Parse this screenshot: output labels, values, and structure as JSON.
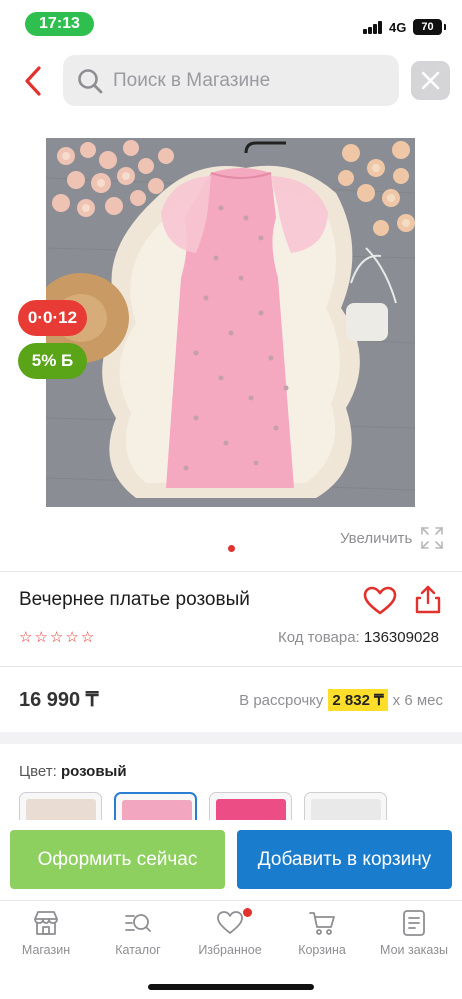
{
  "status_bar": {
    "time": "17:13",
    "network": "4G",
    "battery": "70"
  },
  "search": {
    "placeholder": "Поиск в Магазине"
  },
  "product": {
    "badge_timer": "0·0·12",
    "badge_cashback": "5% Б",
    "zoom_label": "Увеличить",
    "title": "Вечернее платье розовый",
    "rating_stars": 5,
    "sku_label": "Код товара:",
    "sku_value": "136309028",
    "price": "16 990 ₸",
    "installment_prefix": "В рассрочку",
    "installment_amount": "2 832 ₸",
    "installment_suffix": "х 6 мес",
    "color_label": "Цвет:",
    "color_value": "розовый",
    "swatches": [
      {
        "color": "#e8dcd3",
        "selected": false
      },
      {
        "color": "#f3a6c0",
        "selected": true
      },
      {
        "color": "#ec4d84",
        "selected": false
      },
      {
        "color": "#e9e9ea",
        "selected": false
      }
    ]
  },
  "actions": {
    "checkout": "Оформить сейчас",
    "add_to_cart": "Добавить в корзину"
  },
  "tabs": [
    {
      "label": "Магазин",
      "icon": "store-icon"
    },
    {
      "label": "Каталог",
      "icon": "catalog-search-icon"
    },
    {
      "label": "Избранное",
      "icon": "heart-icon"
    },
    {
      "label": "Корзина",
      "icon": "cart-icon"
    },
    {
      "label": "Мои заказы",
      "icon": "orders-icon"
    }
  ],
  "colors": {
    "accent_red": "#e2322d",
    "checkout_green": "#8ed05f",
    "cart_blue": "#1a7ccc",
    "installment_yellow": "#ffde2b",
    "dress_pink": "#f4a9c1"
  }
}
